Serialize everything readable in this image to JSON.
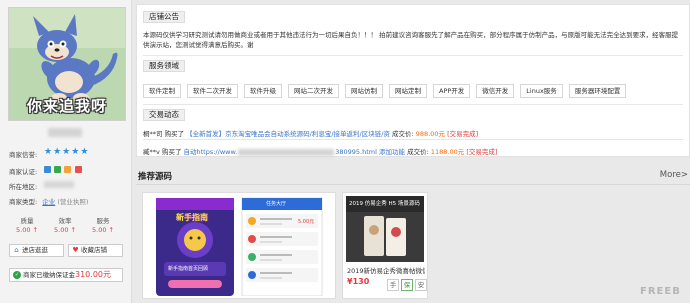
{
  "shop": {
    "avatar_caption": "你来追我呀",
    "credit_label": "商家信誉:",
    "credit_stars": 5,
    "verify_label": "商家认证:",
    "location_label": "所在地区:",
    "type_label": "商家类型:",
    "type_value": "企业",
    "type_note": "(营业执照)",
    "scores": [
      {
        "label": "质量",
        "value": "5.00 ↑"
      },
      {
        "label": "效率",
        "value": "5.00 ↑"
      },
      {
        "label": "服务",
        "value": "5.00 ↑"
      }
    ],
    "visit_button": "进店逛逛",
    "favorite_button": "收藏店铺",
    "deposit_label": "商家已缴纳保证金",
    "deposit_amount": "310.00元"
  },
  "notice": {
    "title": "店铺公告",
    "text": "本源码仅供学习研究测试请勿用做商业或者用于其他违法行为一切后果自负！！！ 拍前建议咨询客服先了解产品在购买，部分程序属于仿制产品，与原版可能无法完全达到要求，经客服提供演示站，您测试觉得满意后购买。谢"
  },
  "services": {
    "title": "服务领域",
    "tags": [
      "软件定制",
      "软件二次开发",
      "软件升级",
      "网站二次开发",
      "网站仿制",
      "网站定制",
      "APP开发",
      "微信开发",
      "Linux服务",
      "服务器环境配置"
    ]
  },
  "deals": {
    "title": "交易动态",
    "items": [
      {
        "buyer": "桐**司",
        "bought": "购买了",
        "link": "【全新首发】京东淘宝唯品会自动系统源码/利息宝/接单返利/区块链/资",
        "price_label": "成交价:",
        "price": "988.00元",
        "status": "[交易完成]"
      },
      {
        "buyer": "臧**v",
        "bought": "购买了",
        "link_prefix": "自动https://www.",
        "link_suffix": "380995.html 添加功能",
        "price_label": "成交价:",
        "price": "1188.00元",
        "status": "[交易完成]"
      }
    ]
  },
  "recommend": {
    "title": "推荐源码",
    "more": "More>",
    "cards": [
      {
        "name": "",
        "price": "",
        "phone_a_title": "新手指南",
        "phone_a_btn": "新手指南首页回顾",
        "phone_b_title": "任务大厅",
        "phone_b_amount": "5.00元"
      },
      {
        "name": "2019新仿易企秀微喜帖微信场景",
        "price": "¥130",
        "banner_text": "2019 仿易企秀 H5 场景源码",
        "badges": [
          "手",
          "保",
          "安"
        ]
      }
    ]
  },
  "watermark": "FREEB"
}
